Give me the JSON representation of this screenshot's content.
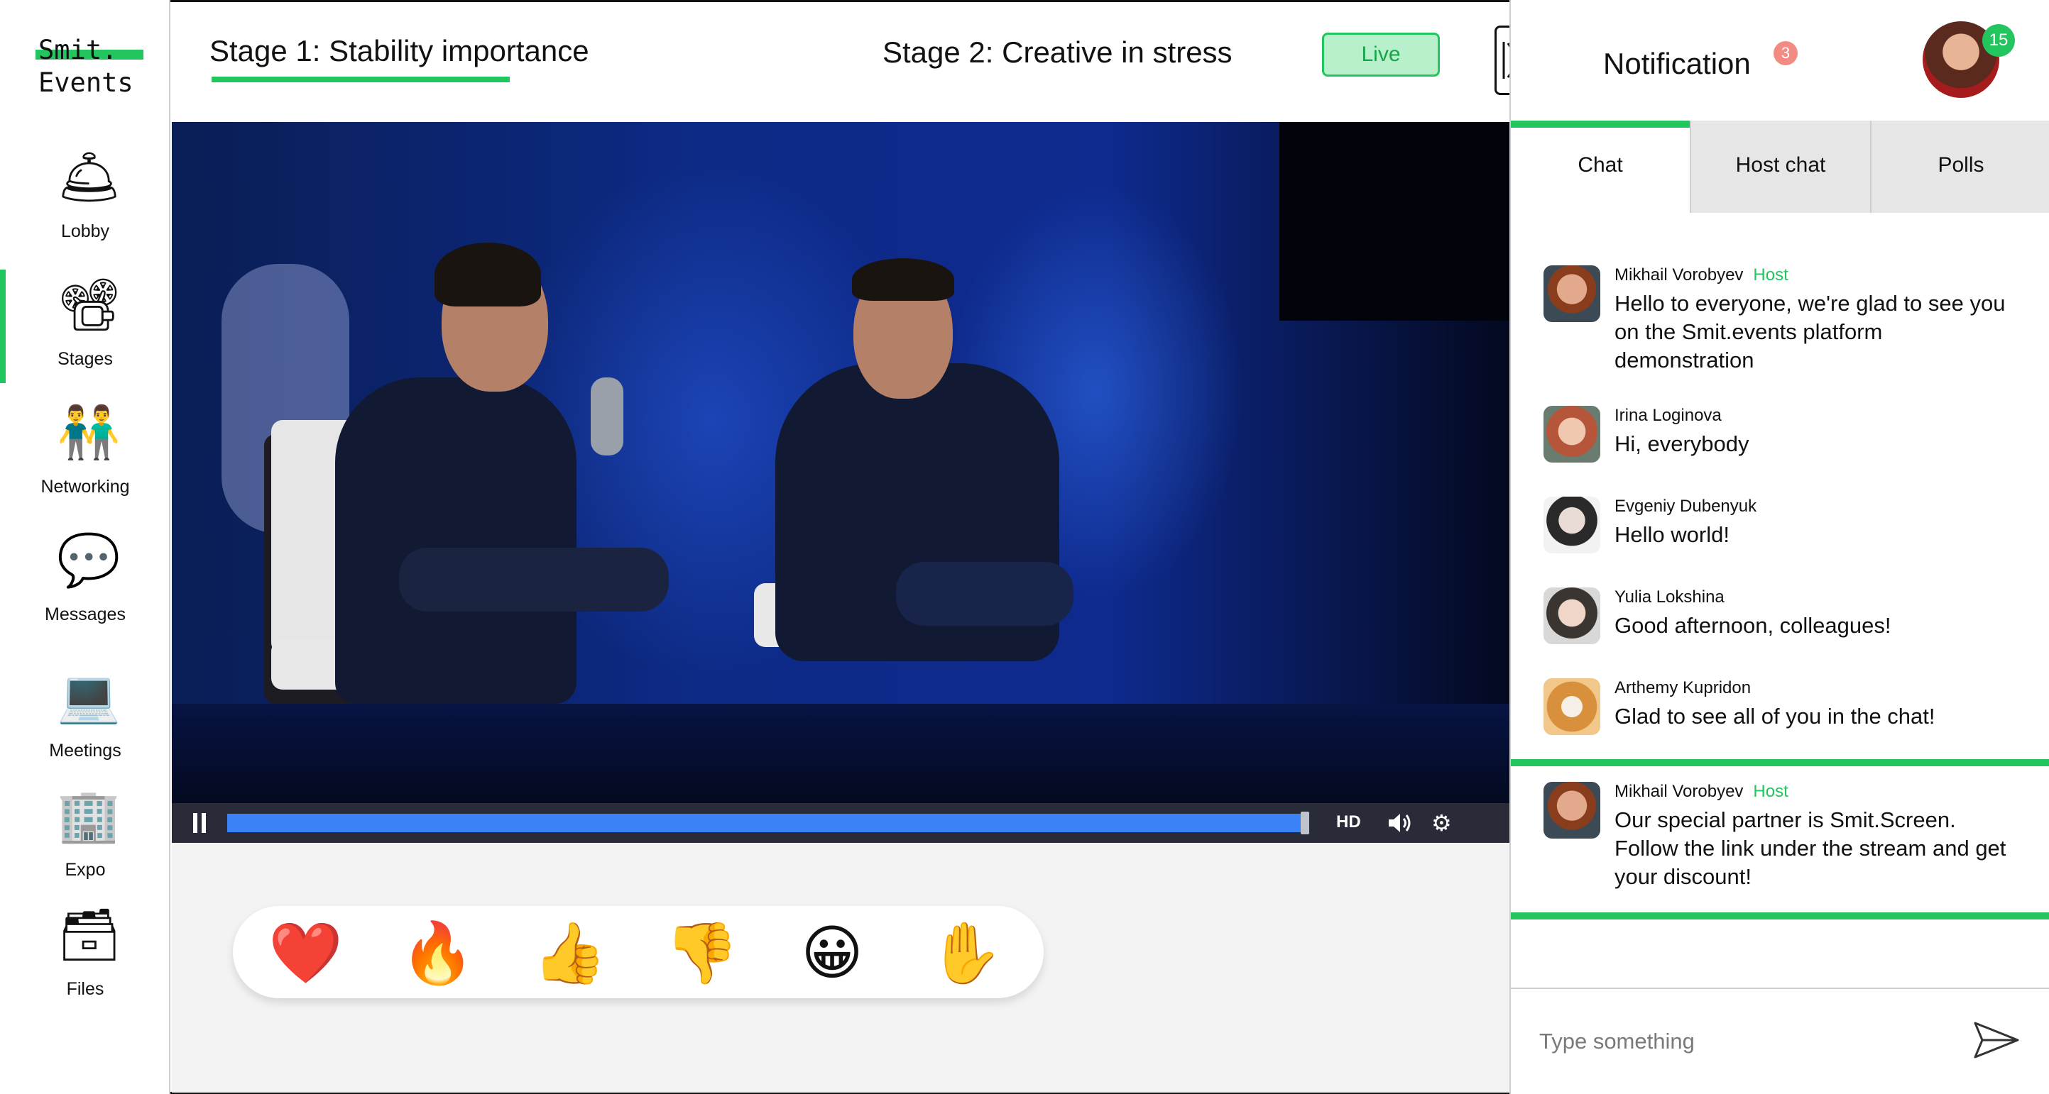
{
  "logo": {
    "line1": "Smit.",
    "line2": "Events"
  },
  "sidebar": {
    "items": [
      {
        "label": "Lobby",
        "icon": "bell-icon",
        "glyph": "🛎"
      },
      {
        "label": "Stages",
        "icon": "film-projector-icon",
        "glyph": "📽"
      },
      {
        "label": "Networking",
        "icon": "people-icon",
        "glyph": "👬"
      },
      {
        "label": "Messages",
        "icon": "speech-bubble-icon",
        "glyph": "💬"
      },
      {
        "label": "Meetings",
        "icon": "laptop-icon",
        "glyph": "💻"
      },
      {
        "label": "Expo",
        "icon": "building-icon",
        "glyph": "🏢"
      },
      {
        "label": "Files",
        "icon": "file-cabinet-icon",
        "glyph": "🗃"
      }
    ],
    "active": "Stages"
  },
  "topbar": {
    "stage1": "Stage 1: Stability importance",
    "stage2": "Stage 2: Creative in stress",
    "live": "Live"
  },
  "player": {
    "quality": "HD",
    "progress_fraction": 0.99
  },
  "reactions": [
    {
      "name": "heart-icon",
      "glyph": "❤️"
    },
    {
      "name": "fire-icon",
      "glyph": "🔥"
    },
    {
      "name": "thumbs-up-icon",
      "glyph": "👍"
    },
    {
      "name": "thumbs-down-icon",
      "glyph": "👎"
    },
    {
      "name": "smile-icon",
      "glyph": "😀"
    },
    {
      "name": "raised-hand-icon",
      "glyph": "✋"
    }
  ],
  "panel": {
    "notification_title": "Notification",
    "notification_count": "3",
    "avatar_count": "15",
    "tabs": [
      "Chat",
      "Host chat",
      "Polls"
    ],
    "messages": [
      {
        "name": "Mikhail Vorobyev",
        "role": "Host",
        "text": "Hello to everyone, we're glad to see you on the Smit.events platform demonstration"
      },
      {
        "name": "Irina Loginova",
        "role": "",
        "text": "Hi, everybody"
      },
      {
        "name": "Evgeniy Dubenyuk",
        "role": "",
        "text": "Hello world!"
      },
      {
        "name": "Yulia Lokshina",
        "role": "",
        "text": "Good afternoon, colleagues!"
      },
      {
        "name": "Arthemy Kupridon",
        "role": "",
        "text": "Glad to see all of you in the chat!"
      }
    ],
    "pinned": {
      "name": "Mikhail Vorobyev",
      "role": "Host",
      "text": "Our special partner is Smit.Screen. Follow the link under the stream and get your discount!"
    },
    "input_placeholder": "Type something"
  },
  "colors": {
    "accent": "#22c55e",
    "progress": "#3b82f6",
    "badge": "#f28b82"
  }
}
